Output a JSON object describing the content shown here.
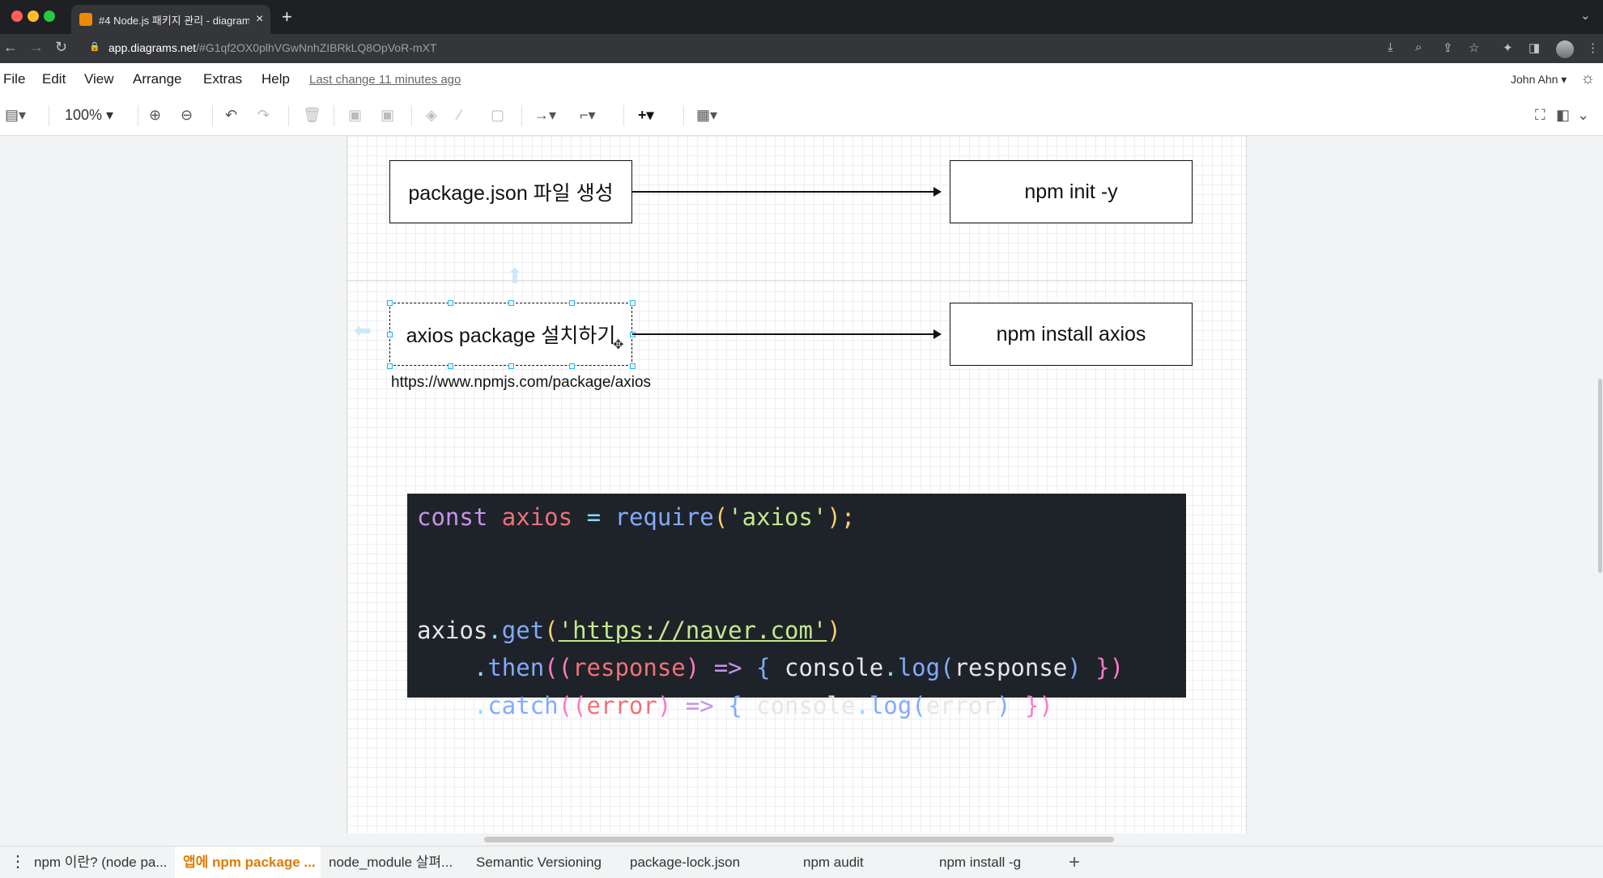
{
  "browser": {
    "tab_title": "#4 Node.js 패키지 관리 - diagram",
    "tab_close": "×",
    "new_tab": "+",
    "url_host": "app.diagrams.net",
    "url_path": "/#G1qf2OX0plhVGwNnhZIBRkLQ8OpVoR-mXT",
    "nav": {
      "back": "←",
      "forward": "→",
      "reload": "↻",
      "lock": "🔒"
    },
    "traffic_colors": [
      "#ff5f57",
      "#febc2e",
      "#28c840"
    ]
  },
  "menubar": {
    "items": [
      "File",
      "Edit",
      "View",
      "Arrange",
      "Extras",
      "Help"
    ],
    "last_change": "Last change 11 minutes ago",
    "user": "John Ahn ▾",
    "theme_icon": "☼"
  },
  "toolbar": {
    "zoom": "100%",
    "panel_icon": "▤▾",
    "zoom_in": "⊕",
    "zoom_out": "⊖",
    "undo": "↶",
    "redo": "↷",
    "delete": "🗑",
    "to_front": "▣",
    "to_back": "▣",
    "fill": "◈",
    "line": "∕",
    "shadow": "▢",
    "connection": "→▾",
    "waypoints": "⌐▾",
    "insert": "+▾",
    "table": "▦▾",
    "fullscreen": "⛶",
    "format": "◧",
    "collapse": "⌄"
  },
  "diagram": {
    "box1": "package.json 파일 생성",
    "box2": "npm init -y",
    "box3": "axios package 설치하기",
    "box4": "npm install axios",
    "link": "https://www.npmjs.com/package/axios"
  },
  "code": {
    "l1": {
      "a": "const",
      "b": "axios",
      "c": "=",
      "d": "require",
      "e": "(",
      "f": "'axios'",
      "g": ");"
    },
    "l3": {
      "a": "axios",
      "b": ".",
      "c": "get",
      "d": "(",
      "e": "'https://naver.com'",
      "f": ")"
    },
    "l4": {
      "a": ".",
      "b": "then",
      "c": "((",
      "d": "response",
      "e": ")",
      "f": "=>",
      "g": "{",
      "h": "console",
      "i": ".",
      "j": "log",
      "k": "(",
      "l": "response",
      "m": ")",
      "n": "})"
    },
    "l5": {
      "a": ".",
      "b": "catch",
      "c": "((",
      "d": "error",
      "e": ")",
      "f": "=>",
      "g": "{",
      "h": "console",
      "i": ".",
      "j": "log",
      "k": "(",
      "l": "error",
      "m": ")",
      "n": "})"
    }
  },
  "page_tabs": {
    "menu_icon": "⋮",
    "tabs": [
      "npm 이란? (node pa...",
      "앱에 npm package ...",
      "node_module 살펴...",
      "Semantic Versioning",
      "package-lock.json",
      "npm audit",
      "npm install -g"
    ],
    "add": "+"
  }
}
